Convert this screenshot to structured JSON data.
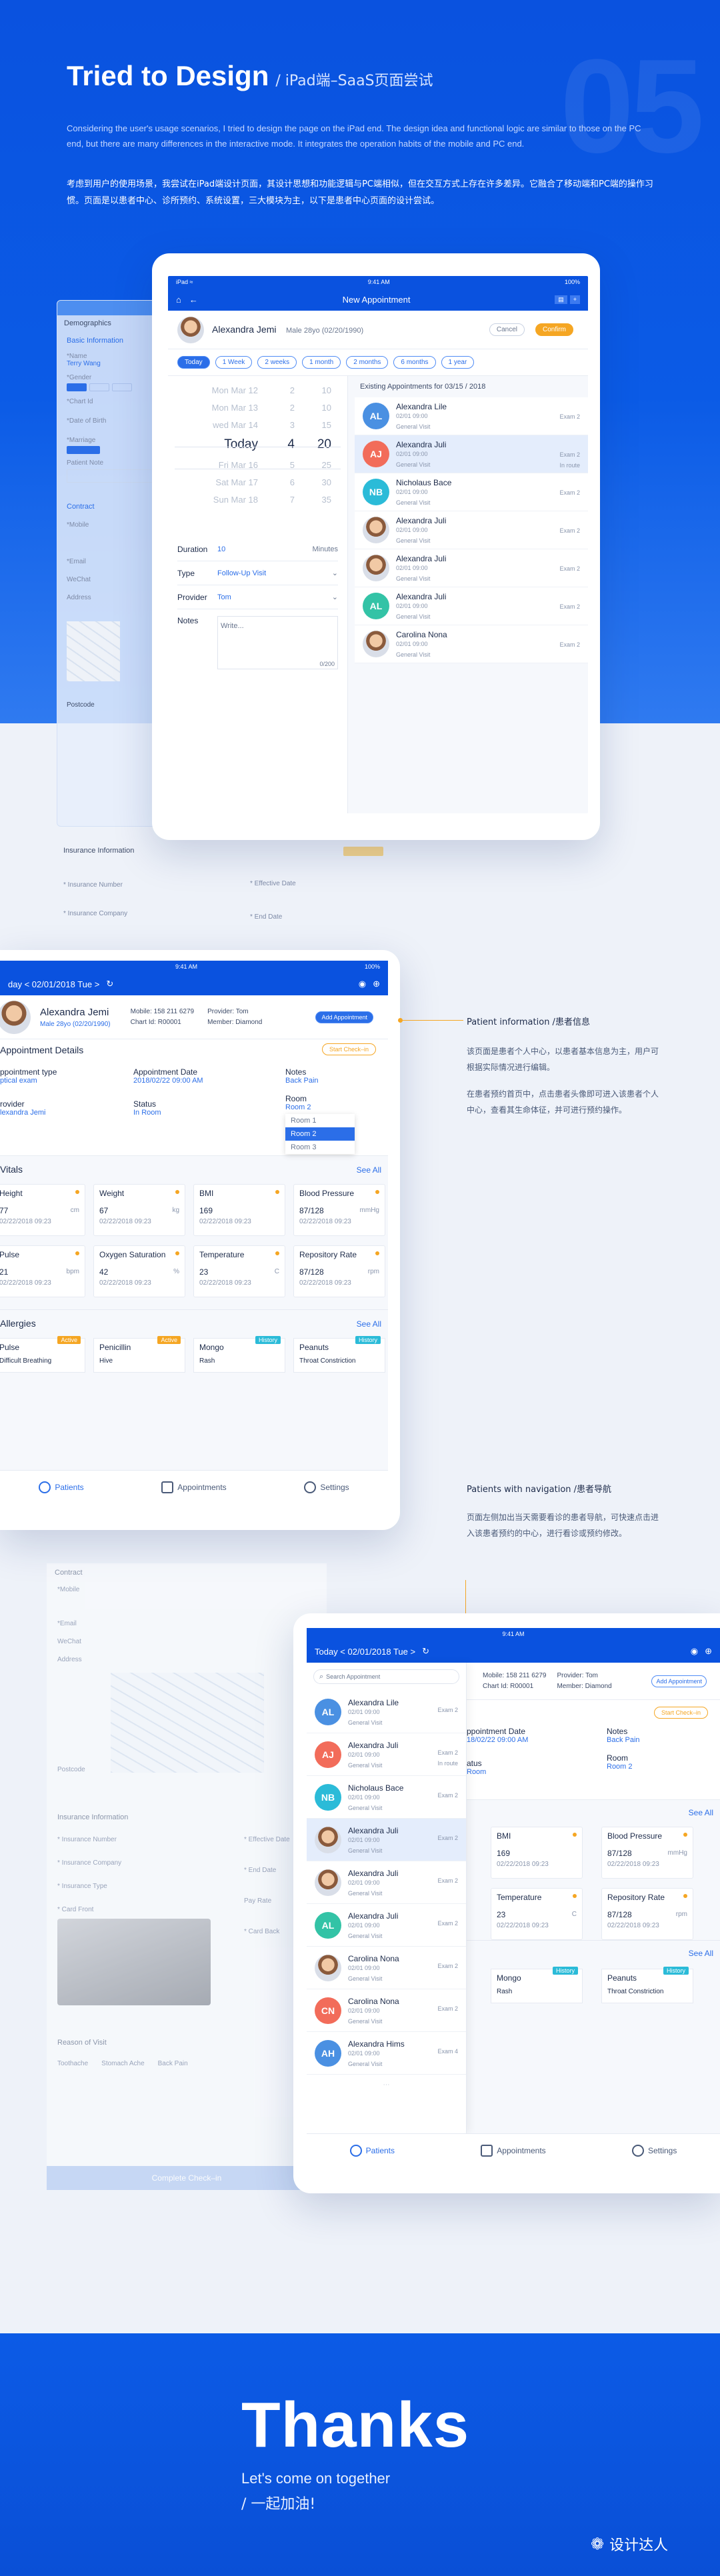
{
  "hero": {
    "bignum": "05",
    "title": "Tried to Design",
    "subtitle": "/ iPad端–SaaS页面尝试",
    "en_text": "Considering the user's usage scenarios, I tried to design the page on the iPad end. The design idea and functional logic are similar to those on the PC end, but there are many differences in the interactive mode. It integrates the operation habits of the mobile and PC end.",
    "cn_text": "考虑到用户的使用场景，我尝试在iPad端设计页面，其设计思想和功能逻辑与PC端相似，但在交互方式上存在许多差异。它融合了移动端和PC端的操作习惯。页面是以患者中心、诊所预约、系统设置，三大模块为主，以下是患者中心页面的设计尝试。"
  },
  "ipad1": {
    "status_left": "iPad ≈",
    "status_time": "9:41 AM",
    "status_right": "100%",
    "nav_title": "New Appointment",
    "patient_name": "Alexandra Jemi",
    "patient_meta": "Male  28yo (02/20/1990)",
    "cancel": "Cancel",
    "confirm": "Confirm",
    "ranges": [
      "Today",
      "1 Week",
      "2 weeks",
      "1 month",
      "2 months",
      "6 months",
      "1 year"
    ],
    "picker": [
      {
        "d": "Mon Mar 12",
        "h": "2",
        "m": "10"
      },
      {
        "d": "Mon Mar 13",
        "h": "2",
        "m": "10"
      },
      {
        "d": "wed Mar 14",
        "h": "3",
        "m": "15"
      },
      {
        "d": "Today",
        "h": "4",
        "m": "20"
      },
      {
        "d": "Fri Mar 16",
        "h": "5",
        "m": "25"
      },
      {
        "d": "Sat Mar 17",
        "h": "6",
        "m": "30"
      },
      {
        "d": "Sun Mar 18",
        "h": "7",
        "m": "35"
      }
    ],
    "duration_label": "Duration",
    "duration_val": "10",
    "duration_unit": "Minutes",
    "type_label": "Type",
    "type_val": "Follow-Up Visit",
    "provider_label": "Provider",
    "provider_val": "Tom",
    "notes_label": "Notes",
    "notes_placeholder": "Write...",
    "notes_count": "0/200",
    "existing_title": "Existing Appointments  for  03/15 / 2018",
    "appts": [
      {
        "ini": "AL",
        "c": "#4a90e2",
        "name": "Alexandra Lile",
        "time": "02/01 09:00",
        "type": "General Visit",
        "exam": "Exam 2",
        "st": ""
      },
      {
        "ini": "AJ",
        "c": "#f26c5a",
        "name": "Alexandra Juli",
        "time": "02/01 09:00",
        "type": "General Visit",
        "exam": "Exam 2",
        "st": "In route"
      },
      {
        "ini": "NB",
        "c": "#2bbbd8",
        "name": "Nicholaus Bace",
        "time": "02/01 09:00",
        "type": "General Visit",
        "exam": "Exam 2",
        "st": ""
      },
      {
        "ini": "",
        "c": "",
        "name": "Alexandra Juli",
        "time": "02/01 09:00",
        "type": "General Visit",
        "exam": "Exam 2",
        "st": ""
      },
      {
        "ini": "",
        "c": "",
        "name": "Alexandra Juli",
        "time": "02/01 09:00",
        "type": "General Visit",
        "exam": "Exam 2",
        "st": ""
      },
      {
        "ini": "AL",
        "c": "#33c3a6",
        "name": "Alexandra Juli",
        "time": "02/01 09:00",
        "type": "General Visit",
        "exam": "Exam 2",
        "st": ""
      },
      {
        "ini": "",
        "c": "",
        "name": "Carolina Nona",
        "time": "02/01 09:00",
        "type": "General Visit",
        "exam": "Exam 2",
        "st": ""
      }
    ]
  },
  "ghost1": {
    "header": "Demographics",
    "basic": "Basic Information",
    "fields": [
      "*Name",
      "*Gender",
      "*Chart Id",
      "*Date of Birth",
      "*Marriage",
      "Patient Note"
    ],
    "name_val": "Terry Wang",
    "contract": "Contract",
    "mobile": "*Mobile",
    "email": "*Email",
    "wechat": "WeChat",
    "address": "Address",
    "postcode": "Postcode",
    "insurance": "Insurance Information",
    "ins_number": "* Insurance Number",
    "eff_date": "* Effective Date",
    "ins_company": "* Insurance Company",
    "end_date": "* End Date"
  },
  "ipad2": {
    "status_time": "9:41 AM",
    "status_right": "100%",
    "nav_date": "day  <  02/01/2018 Tue  >",
    "patient_name": "Alexandra Jemi",
    "patient_meta": "Male  28yo (02/20/1990)",
    "mobile": "Mobile:  158 211 6279",
    "chart": "Chart Id:  R00001",
    "provider": "Provider:  Tom",
    "member": "Member:  Diamond",
    "add_appt": "Add Appointment",
    "start_checkin": "Start Check–in",
    "appt_details": "Appointment Details",
    "appt_type_label": "ppointment type",
    "appt_type_val": "ptical exam",
    "appt_date_label": "Appointment Date",
    "appt_date_val": "2018/02/22 09:00 AM",
    "notes_label": "Notes",
    "notes_val": "Back Pain",
    "provider_label": "rovider",
    "provider_val": "lexandra Jemi",
    "status_label": "Status",
    "status_val": "In Room",
    "room_label": "Room",
    "room_val": "Room 2",
    "room_opts": [
      "Room 1",
      "Room 2",
      "Room 3"
    ],
    "vitals_title": "Vitals",
    "see_all": "See All",
    "vitals": [
      {
        "t": "Height",
        "v": "77",
        "u": "cm",
        "d": "02/22/2018   09:23"
      },
      {
        "t": "Weight",
        "v": "67",
        "u": "kg",
        "d": "02/22/2018   09:23"
      },
      {
        "t": "BMI",
        "v": "169",
        "u": "",
        "d": "02/22/2018   09:23"
      },
      {
        "t": "Blood Pressure",
        "v": "87/128",
        "u": "mmHg",
        "d": "02/22/2018   09:23"
      },
      {
        "t": "Pulse",
        "v": "21",
        "u": "bpm",
        "d": "02/22/2018   09:23"
      },
      {
        "t": "Oxygen Saturation",
        "v": "42",
        "u": "%",
        "d": "02/22/2018   09:23"
      },
      {
        "t": "Temperature",
        "v": "23",
        "u": "C",
        "d": "02/22/2018   09:23"
      },
      {
        "t": "Repository Rate",
        "v": "87/128",
        "u": "rpm",
        "d": "02/22/2018   09:23"
      }
    ],
    "allergies_title": "Allergies",
    "allergies": [
      {
        "t": "Pulse",
        "s": "Difficult Breathing",
        "tag": "Active",
        "tc": "#f5a623"
      },
      {
        "t": "Penicillin",
        "s": "Hive",
        "tag": "Active",
        "tc": "#f5a623"
      },
      {
        "t": "Mongo",
        "s": "Rash",
        "tag": "History",
        "tc": "#2bbbd8"
      },
      {
        "t": "Peanuts",
        "s": "Throat Constriction",
        "tag": "History",
        "tc": "#2bbbd8"
      }
    ],
    "tabs": [
      "Patients",
      "Appointments",
      "Settings"
    ]
  },
  "note1": {
    "title": "Patient information /患者信息",
    "p1": "该页面是患者个人中心，以患者基本信息为主，用户可根据实际情况进行编辑。",
    "p2": "在患者预约首页中，点击患者头像即可进入该患者个人中心，查看其生命体征，并可进行预约操作。"
  },
  "note2": {
    "title": "Patients with navigation /患者导航",
    "p1": "页面左侧加出当天需要看诊的患者导航，可快速点击进入该患者预约的中心，进行看诊或预约修改。"
  },
  "ghost2": {
    "contract": "Contract",
    "mobile": "*Mobile",
    "email": "*Email",
    "wechat": "WeChat",
    "address": "Address",
    "postcode": "Postcode",
    "insurance": "Insurance Information",
    "ins_number": "* Insurance Number",
    "eff_date": "* Effective Date",
    "ins_company": "* Insurance Company",
    "end_date": "* End Date",
    "ins_type": "* Insurance Type",
    "pay_rate": "Pay Rate",
    "card_front": "* Card Front",
    "card_back": "* Card Back",
    "reason": "Reason of Visit",
    "reasons": [
      "Toothache",
      "Stomach Ache",
      "Back Pain"
    ],
    "complete": "Complete Check–in"
  },
  "ipad3": {
    "status_time": "9:41 AM",
    "nav_date": "Today  <  02/01/2018 Tue  >",
    "search_placeholder": "Search Appointment",
    "mobile": "Mobile:  158 211 6279",
    "chart": "Chart Id:  R00001",
    "provider": "Provider:  Tom",
    "member": "Member:  Diamond",
    "add_appt": "Add Appointment",
    "start_checkin": "Start Check–in",
    "appt_date_label": "ppointment Date",
    "appt_date_val": "18/02/22 09:00 AM",
    "notes_label": "Notes",
    "notes_val": "Back Pain",
    "status_label": "atus",
    "status_val": "Room",
    "room_label": "Room",
    "room_val": "Room 2",
    "see_all": "See All",
    "list": [
      {
        "ini": "AL",
        "c": "#4a90e2",
        "name": "Alexandra Lile",
        "time": "02/01 09:00",
        "type": "General Visit",
        "exam": "Exam 2",
        "st": ""
      },
      {
        "ini": "AJ",
        "c": "#f26c5a",
        "name": "Alexandra Juli",
        "time": "02/01 09:00",
        "type": "General Visit",
        "exam": "Exam 2",
        "st": "In route"
      },
      {
        "ini": "NB",
        "c": "#2bbbd8",
        "name": "Nicholaus Bace",
        "time": "02/01 09:00",
        "type": "General Visit",
        "exam": "Exam 2",
        "st": ""
      },
      {
        "ini": "",
        "c": "",
        "name": "Alexandra Juli",
        "time": "02/01 09:00",
        "type": "General Visit",
        "exam": "Exam 2",
        "st": ""
      },
      {
        "ini": "",
        "c": "",
        "name": "Alexandra Juli",
        "time": "02/01 09:00",
        "type": "General Visit",
        "exam": "Exam 2",
        "st": ""
      },
      {
        "ini": "AL",
        "c": "#33c3a6",
        "name": "Alexandra Juli",
        "time": "02/01 09:00",
        "type": "General Visit",
        "exam": "Exam 2",
        "st": ""
      },
      {
        "ini": "",
        "c": "",
        "name": "Carolina Nona",
        "time": "02/01 09:00",
        "type": "General Visit",
        "exam": "Exam 2",
        "st": ""
      },
      {
        "ini": "CN",
        "c": "#f26c5a",
        "name": "Carolina Nona",
        "time": "02/01 09:00",
        "type": "General Visit",
        "exam": "Exam 2",
        "st": ""
      },
      {
        "ini": "AH",
        "c": "#4a90e2",
        "name": "Alexandra Hims",
        "time": "02/01 09:00",
        "type": "General Visit",
        "exam": "Exam 4",
        "st": ""
      }
    ],
    "vitals": [
      {
        "t": "BMI",
        "v": "169",
        "u": "",
        "d": "02/22/2018   09:23"
      },
      {
        "t": "Blood Pressure",
        "v": "87/128",
        "u": "mmHg",
        "d": "02/22/2018   09:23"
      },
      {
        "t": "Temperature",
        "v": "23",
        "u": "C",
        "d": "02/22/2018   09:23"
      },
      {
        "t": "Repository Rate",
        "v": "87/128",
        "u": "rpm",
        "d": "02/22/2018   09:23"
      }
    ],
    "allergies": [
      {
        "t": "Mongo",
        "s": "Rash",
        "tag": "History"
      },
      {
        "t": "Peanuts",
        "s": "Throat Constriction",
        "tag": "History"
      }
    ],
    "tabs": [
      "Patients",
      "Appointments",
      "Settings"
    ]
  },
  "thanks": {
    "big": "Thanks",
    "line1": "Let's come on together",
    "line2": "/ 一起加油!",
    "brand": "设计达人"
  },
  "colors": {
    "primary": "#0a52df",
    "accent": "#2b6ee8",
    "orange": "#f5a623"
  }
}
